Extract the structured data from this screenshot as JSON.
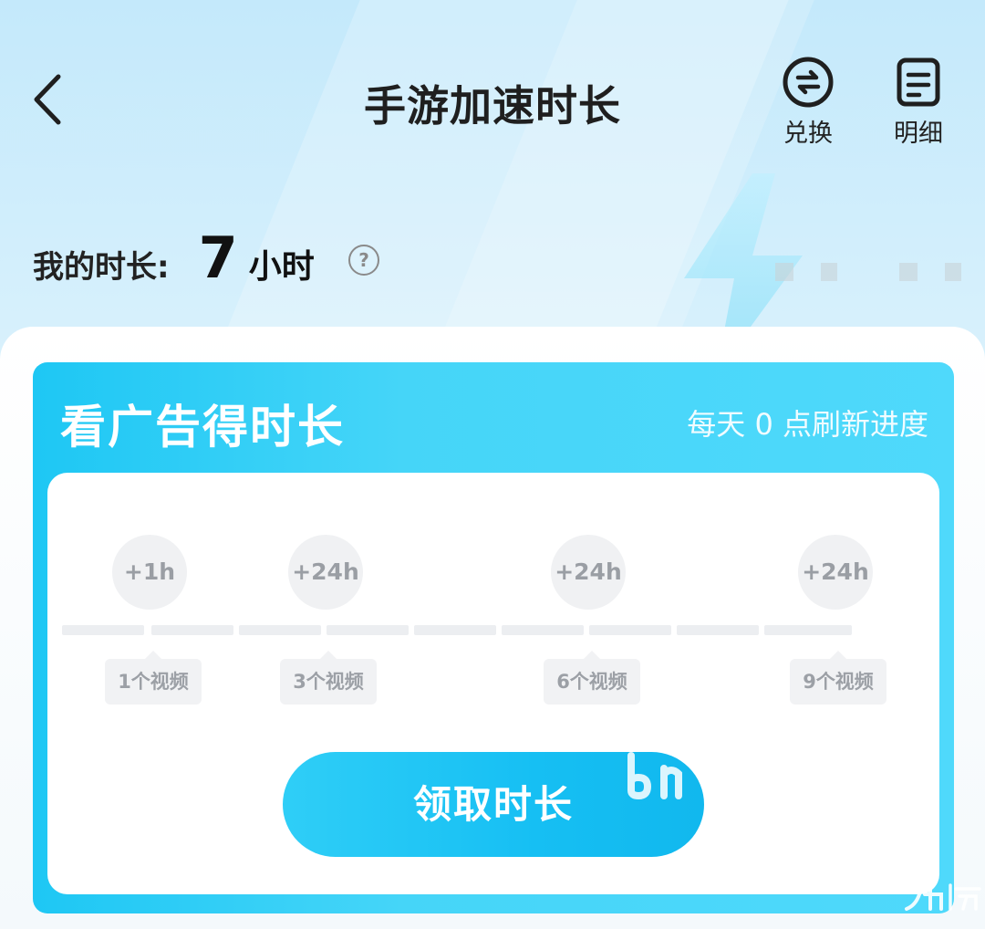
{
  "header": {
    "title": "手游加速时长",
    "actions": [
      {
        "label": "兑换",
        "icon": "exchange-icon"
      },
      {
        "label": "明细",
        "icon": "detail-icon"
      }
    ]
  },
  "my_duration": {
    "label": "我的时长:",
    "value": "7",
    "unit": "小时"
  },
  "ad_card": {
    "title": "看广告得时长",
    "refresh_note": "每天 0 点刷新进度",
    "milestones": [
      {
        "reward": "+1h",
        "videos": "1个视频"
      },
      {
        "reward": "+24h",
        "videos": "3个视频"
      },
      {
        "reward": "+24h",
        "videos": "6个视频"
      },
      {
        "reward": "+24h",
        "videos": "9个视频"
      }
    ],
    "progress": {
      "watched": 0,
      "total": 9
    },
    "claim_button": "领取时长"
  },
  "colors": {
    "accent": "#1ec7f4",
    "button": "#16bff3",
    "inactive": "#eceef1"
  }
}
